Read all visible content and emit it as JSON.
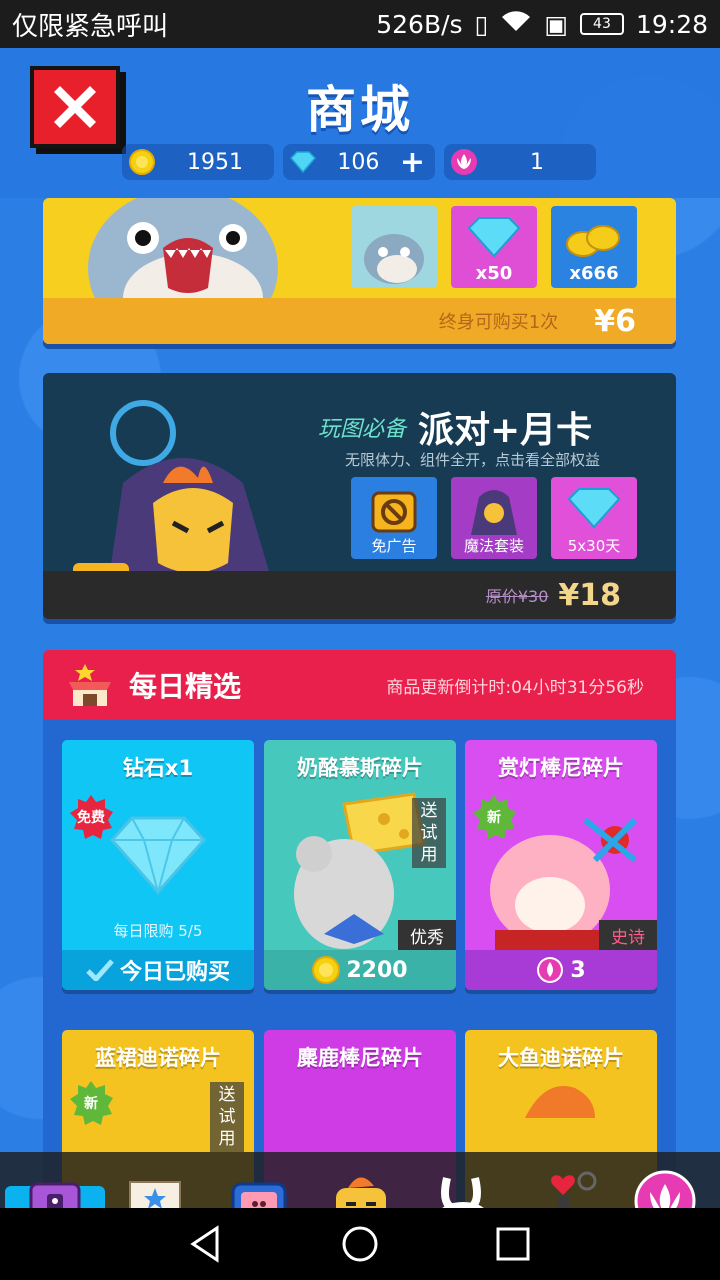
{
  "status_bar": {
    "carrier": "仅限紧急呼叫",
    "speed": "526B/s",
    "battery": "43",
    "time": "19:28"
  },
  "header": {
    "title": "商城",
    "currencies": [
      {
        "name": "coin",
        "value": "1951"
      },
      {
        "name": "diamond",
        "value": "106",
        "plus": "+"
      },
      {
        "name": "lotus",
        "value": "1"
      }
    ]
  },
  "shark_pack": {
    "tiles": [
      {
        "icon": "shark-skin",
        "label": ""
      },
      {
        "icon": "diamond-pile",
        "label": "x50"
      },
      {
        "icon": "gold-coins",
        "label": "x666"
      }
    ],
    "limit_text": "终身可购买1次",
    "price": "¥6"
  },
  "party_card": {
    "pre_title": "玩图必备",
    "title": "派对+月卡",
    "subtitle": "无限体力、组件全开，点击看全部权益",
    "tiles": [
      {
        "label": "免广告"
      },
      {
        "label": "魔法套装"
      },
      {
        "label": "5x30天"
      }
    ],
    "original_price": "原价¥30",
    "price": "¥18"
  },
  "daily": {
    "title": "每日精选",
    "countdown": "商品更新倒计时:04小时31分56秒",
    "items": [
      {
        "name": "钻石x1",
        "badge": "免费",
        "limit": "每日限购 5/5",
        "footer": "今日已购买",
        "footer_icon": "check-icon"
      },
      {
        "name": "奶酪慕斯碎片",
        "trial": "送试用",
        "rarity": "优秀",
        "footer": "2200",
        "footer_icon": "coin-icon"
      },
      {
        "name": "赏灯棒尼碎片",
        "badge": "新",
        "rarity": "史诗",
        "footer": "3",
        "footer_icon": "lotus-icon"
      },
      {
        "name": "蓝裙迪诺碎片",
        "badge": "新",
        "trial": "送试用"
      },
      {
        "name": "麋鹿棒尼碎片"
      },
      {
        "name": "大鱼迪诺碎片"
      }
    ]
  },
  "bottom_nav": [
    "treasure-chest",
    "star-speech",
    "pig-tv",
    "yellow-bird",
    "white-bunny",
    "heart-stamp",
    "lotus"
  ],
  "colors": {
    "app_bg": "#2b7ee4",
    "close_red": "#e8202b",
    "daily_head": "#e9204b",
    "shark_card": "#f7cf1e",
    "party_card": "#163b53"
  }
}
